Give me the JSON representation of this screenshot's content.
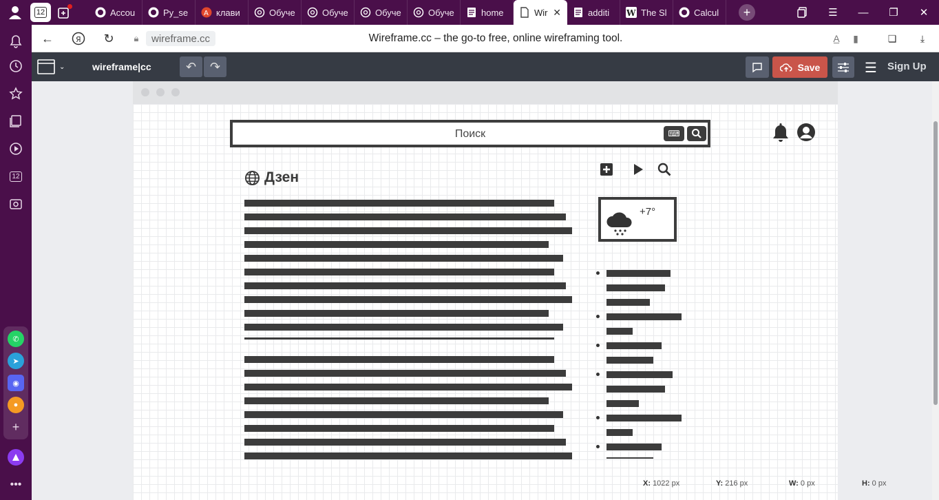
{
  "browser": {
    "pinned_tab_number": "12",
    "tabs": [
      {
        "title": "Accou",
        "icon": "github-icon"
      },
      {
        "title": "Py_se",
        "icon": "github-icon"
      },
      {
        "title": "клави",
        "icon": "app-icon"
      },
      {
        "title": "Обуче",
        "icon": "openai-icon"
      },
      {
        "title": "Обуче",
        "icon": "openai-icon"
      },
      {
        "title": "Обуче",
        "icon": "openai-icon"
      },
      {
        "title": "Обуче",
        "icon": "openai-icon"
      },
      {
        "title": "home",
        "icon": "doc-icon"
      },
      {
        "title": "Wir",
        "icon": "page-icon",
        "active": true
      },
      {
        "title": "additi",
        "icon": "doc-icon"
      },
      {
        "title": "The Sl",
        "icon": "wikipedia-icon"
      },
      {
        "title": "Calcul",
        "icon": "github-icon"
      }
    ],
    "url": "wireframe.cc",
    "page_title": "Wireframe.cc – the go-to free, online wireframing tool.",
    "sidebar_badge": "12"
  },
  "toolbar": {
    "logo": "wireframe|cc",
    "save_label": "Save",
    "signup_label": "Sign Up"
  },
  "wireframe": {
    "search_placeholder": "Поиск",
    "brand_name": "Дзен",
    "weather_temp": "+7°"
  },
  "status": {
    "x_label": "X:",
    "x_value": "1022 px",
    "y_label": "Y:",
    "y_value": "216 px",
    "w_label": "W:",
    "w_value": "0 px",
    "h_label": "H:",
    "h_value": "0 px"
  },
  "colors": {
    "browser_chrome": "#4a0f4a",
    "app_toolbar": "#363b44",
    "save_button": "#c9554a",
    "wireframe_ink": "#3c3c3c"
  }
}
